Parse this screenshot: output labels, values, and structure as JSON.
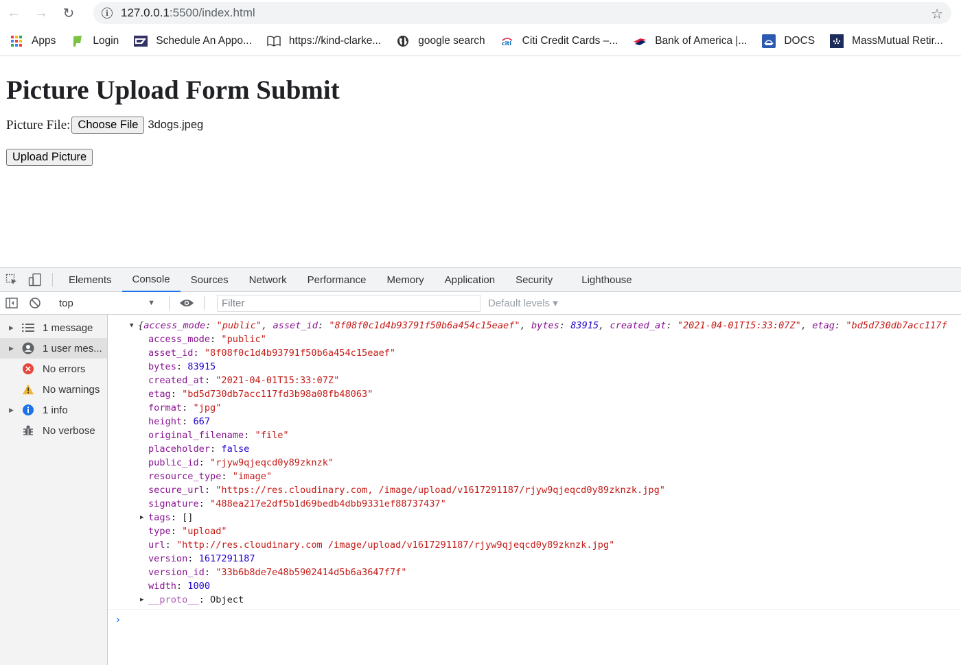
{
  "browser": {
    "url_host": "127.0.0.1",
    "url_path": ":5500/index.html",
    "bookmarks": [
      {
        "label": "Apps",
        "icon": "apps-grid-icon"
      },
      {
        "label": "Login",
        "icon": "login-icon"
      },
      {
        "label": "Schedule An Appo...",
        "icon": "usps-icon"
      },
      {
        "label": "https://kind-clarke...",
        "icon": "book-icon"
      },
      {
        "label": "google search",
        "icon": "globe-icon"
      },
      {
        "label": "Citi Credit Cards –...",
        "icon": "citi-icon"
      },
      {
        "label": "Bank of America |...",
        "icon": "bofa-icon"
      },
      {
        "label": "DOCS",
        "icon": "docs-icon"
      },
      {
        "label": "MassMutual Retir...",
        "icon": "massmutual-icon"
      }
    ]
  },
  "page": {
    "title": "Picture Upload Form Submit",
    "file_label": "Picture File:",
    "choose_label": "Choose File",
    "file_name": "3dogs.jpeg",
    "upload_label": "Upload Picture"
  },
  "devtools": {
    "tabs": [
      "Elements",
      "Console",
      "Sources",
      "Network",
      "Performance",
      "Memory",
      "Application",
      "Security",
      "Lighthouse"
    ],
    "active_tab": "Console",
    "context": "top",
    "filter_placeholder": "Filter",
    "levels": "Default levels ▾",
    "sidebar": [
      {
        "label": "1 message",
        "icon": "list-icon",
        "expand": true
      },
      {
        "label": "1 user mes...",
        "icon": "user-icon",
        "expand": true
      },
      {
        "label": "No errors",
        "icon": "error-icon",
        "expand": false
      },
      {
        "label": "No warnings",
        "icon": "warning-icon",
        "expand": false
      },
      {
        "label": "1 info",
        "icon": "info-icon",
        "expand": true
      },
      {
        "label": "No verbose",
        "icon": "bug-icon",
        "expand": false
      }
    ],
    "console": {
      "summary": {
        "access_mode": "\"public\"",
        "asset_id": "\"8f08f0c1d4b93791f50b6a454c15eaef\"",
        "bytes": "83915",
        "created_at": "\"2021-04-01T15:33:07Z\"",
        "etag": "\"bd5d730db7acc117f"
      },
      "props": [
        {
          "key": "access_mode",
          "value": "\"public\"",
          "type": "s"
        },
        {
          "key": "asset_id",
          "value": "\"8f08f0c1d4b93791f50b6a454c15eaef\"",
          "type": "s"
        },
        {
          "key": "bytes",
          "value": "83915",
          "type": "n"
        },
        {
          "key": "created_at",
          "value": "\"2021-04-01T15:33:07Z\"",
          "type": "s"
        },
        {
          "key": "etag",
          "value": "\"bd5d730db7acc117fd3b98a08fb48063\"",
          "type": "s"
        },
        {
          "key": "format",
          "value": "\"jpg\"",
          "type": "s"
        },
        {
          "key": "height",
          "value": "667",
          "type": "n"
        },
        {
          "key": "original_filename",
          "value": "\"file\"",
          "type": "s"
        },
        {
          "key": "placeholder",
          "value": "false",
          "type": "n"
        },
        {
          "key": "public_id",
          "value": "\"rjyw9qjeqcd0y89zknzk\"",
          "type": "s"
        },
        {
          "key": "resource_type",
          "value": "\"image\"",
          "type": "s"
        },
        {
          "key": "secure_url",
          "value": "\"https://res.cloudinary.com,      /image/upload/v1617291187/rjyw9qjeqcd0y89zknzk.jpg\"",
          "type": "s"
        },
        {
          "key": "signature",
          "value": "\"488ea217e2df5b1d69bedb4dbb9331ef88737437\"",
          "type": "s"
        },
        {
          "key": "tags",
          "value": "[]",
          "type": "plain",
          "expand": true
        },
        {
          "key": "type",
          "value": "\"upload\"",
          "type": "s"
        },
        {
          "key": "url",
          "value": "\"http://res.cloudinary.com              /image/upload/v1617291187/rjyw9qjeqcd0y89zknzk.jpg\"",
          "type": "s"
        },
        {
          "key": "version",
          "value": "1617291187",
          "type": "n"
        },
        {
          "key": "version_id",
          "value": "\"33b6b8de7e48b5902414d5b6a3647f7f\"",
          "type": "s"
        },
        {
          "key": "width",
          "value": "1000",
          "type": "n"
        },
        {
          "key": "__proto__",
          "value": "Object",
          "type": "plain",
          "expand": true,
          "proto": true
        }
      ],
      "prompt": "›"
    }
  }
}
